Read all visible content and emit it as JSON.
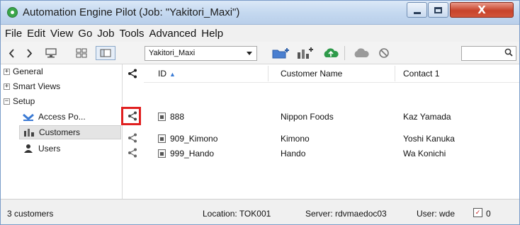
{
  "window": {
    "title": "Automation Engine Pilot (Job: \"Yakitori_Maxi\")",
    "close_label": "X"
  },
  "menu": [
    "File",
    "Edit",
    "View",
    "Go",
    "Job",
    "Tools",
    "Advanced",
    "Help"
  ],
  "toolbar": {
    "job_select_value": "Yakitori_Maxi",
    "search_value": ""
  },
  "sidebar": {
    "items": [
      {
        "label": "General",
        "expander": "+"
      },
      {
        "label": "Smart Views",
        "expander": "+"
      },
      {
        "label": "Setup",
        "expander": "−"
      },
      {
        "label": "Access Po...",
        "icon": "access-point-icon"
      },
      {
        "label": "Customers",
        "icon": "customers-icon",
        "selected": true
      },
      {
        "label": "Users",
        "icon": "user-icon"
      }
    ]
  },
  "grid": {
    "columns": {
      "id": "ID",
      "customer_name": "Customer Name",
      "contact": "Contact 1"
    },
    "sort_indicator": "▲",
    "rows": [
      {
        "id": "888",
        "customer_name": "Nippon Foods",
        "contact": "Kaz Yamada"
      },
      {
        "id": "909_Kimono",
        "customer_name": "Kimono",
        "contact": "Yoshi Kanuka"
      },
      {
        "id": "999_Hando",
        "customer_name": "Hando",
        "contact": "Wa Konichi"
      }
    ]
  },
  "status": {
    "count": "3 customers",
    "location": "Location: TOK001",
    "server": "Server: rdvmaedoc03",
    "user": "User: wde",
    "messages": "0"
  },
  "colors": {
    "highlight": "#e02020",
    "cloud_green": "#2e9a4a",
    "titlebar": "#c5d9f0"
  }
}
